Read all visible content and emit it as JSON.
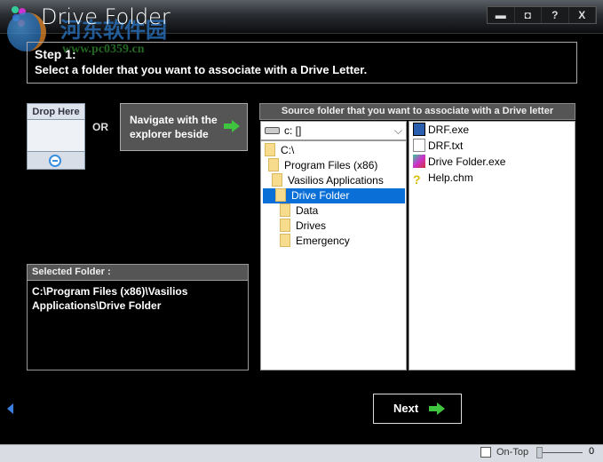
{
  "window": {
    "title": "Drive Folder",
    "buttons": [
      "minimize",
      "restore",
      "?",
      "X"
    ],
    "watermark": {
      "text": "河东软件园",
      "url": "www.pc0359.cn"
    }
  },
  "step": {
    "title": "Step 1:",
    "description": "Select a folder that you want to associate with a  Drive Letter."
  },
  "drop": {
    "label": "Drop Here"
  },
  "or_label": "OR",
  "navigate": {
    "label_line1": "Navigate with the",
    "label_line2": "explorer beside"
  },
  "source": {
    "header": "Source folder that you want to associate with a Drive letter",
    "drive": "c: []",
    "tree": [
      {
        "label": "C:\\",
        "depth": 0
      },
      {
        "label": "Program Files (x86)",
        "depth": 1
      },
      {
        "label": "Vasilios Applications",
        "depth": 2
      },
      {
        "label": "Drive Folder",
        "depth": 3,
        "selected": true
      },
      {
        "label": "Data",
        "depth": 4
      },
      {
        "label": "Drives",
        "depth": 4
      },
      {
        "label": "Emergency",
        "depth": 4
      }
    ],
    "files": [
      {
        "name": "DRF.exe",
        "icon": "exe-icon"
      },
      {
        "name": "DRF.txt",
        "icon": "text-file-icon"
      },
      {
        "name": "Drive Folder.exe",
        "icon": "app-icon"
      },
      {
        "name": "Help.chm",
        "icon": "help-file-icon"
      }
    ]
  },
  "selected": {
    "header": "Selected Folder :",
    "path_line1": "C:\\Program Files (x86)\\Vasilios",
    "path_line2": "Applications\\Drive Folder"
  },
  "next_label": "Next",
  "status": {
    "ontop_label": "On-Top",
    "ontop_checked": false,
    "slider_value": "0"
  },
  "colors": {
    "selection": "#0a6fd6",
    "arrow": "#3ec43e"
  }
}
